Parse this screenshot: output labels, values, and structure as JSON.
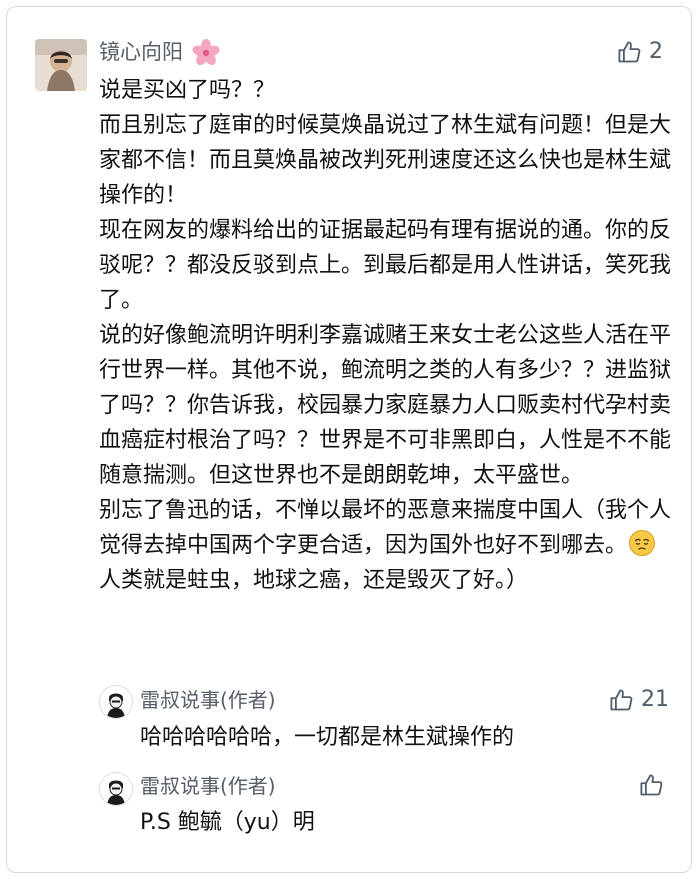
{
  "main_comment": {
    "author": "镜心向阳",
    "author_flair_icon": "cherry-blossom-icon",
    "likes": "2",
    "paragraphs": [
      "说是买凶了吗？？",
      "而且别忘了庭审的时候莫焕晶说过了林生斌有问题！但是大家都不信！而且莫焕晶被改判死刑速度还这么快也是林生斌操作的！",
      "现在网友的爆料给出的证据最起码有理有据说的通。你的反驳呢？？都没反驳到点上。到最后都是用人性讲话，笑死我了。",
      "说的好像鲍流明许明利李嘉诚赌王来女士老公这些人活在平行世界一样。其他不说，鲍流明之类的人有多少？？进监狱了吗？？你告诉我，校园暴力家庭暴力人口贩卖村代孕村卖血癌症村根治了吗？？世界是不可非黑即白，人性是不不能随意揣测。但这世界也不是朗朗乾坤，太平盛世。"
    ],
    "last_part_before_emoji": "别忘了鲁迅的话，不惮以最坏的恶意来揣度中国人（我个人觉得去掉中国两个字更合适，因为国外也好不到哪去。",
    "emoji_icon": "pensive-face-icon",
    "last_part_after_emoji": "人类就是蛀虫，地球之癌，还是毁灭了好。）"
  },
  "replies": [
    {
      "author": "雷叔说事(作者)",
      "likes": "21",
      "text": "哈哈哈哈哈哈，一切都是林生斌操作的"
    },
    {
      "author": "雷叔说事(作者)",
      "likes": "",
      "text": "P.S 鲍毓（yu）明"
    }
  ],
  "colors": {
    "name": "#575f6a",
    "text": "#111111",
    "like_icon": "#4f5c6b"
  }
}
